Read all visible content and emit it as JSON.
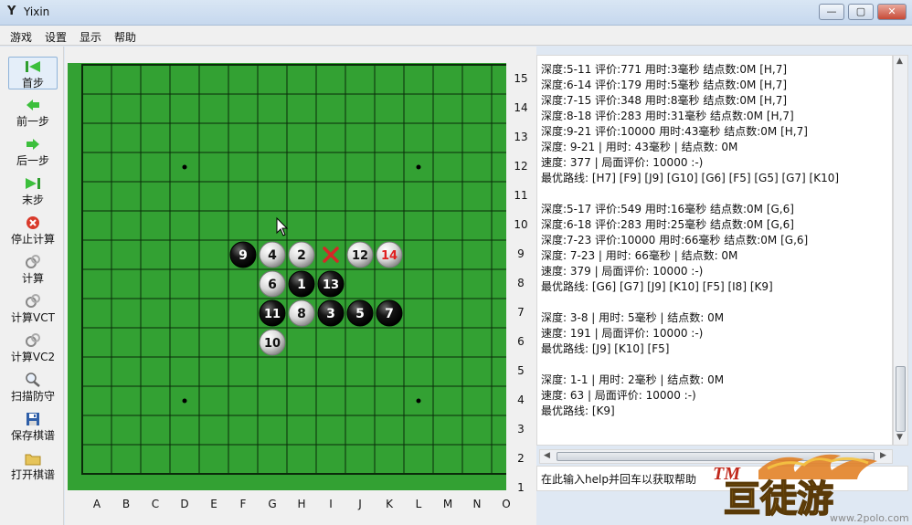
{
  "window": {
    "title": "Yixin",
    "app_icon": "Y",
    "minimize_glyph": "—",
    "maximize_glyph": "▢",
    "close_glyph": "✕"
  },
  "menu": [
    "游戏",
    "设置",
    "显示",
    "帮助"
  ],
  "toolbar": [
    {
      "label": "首步",
      "icon": "first-step-icon",
      "active": true
    },
    {
      "label": "前一步",
      "icon": "prev-step-icon"
    },
    {
      "label": "后一步",
      "icon": "next-step-icon"
    },
    {
      "label": "末步",
      "icon": "last-step-icon"
    },
    {
      "label": "停止计算",
      "icon": "stop-icon"
    },
    {
      "label": "计算",
      "icon": "compute-icon"
    },
    {
      "label": "计算VCT",
      "icon": "compute-vct-icon"
    },
    {
      "label": "计算VC2",
      "icon": "compute-vc2-icon"
    },
    {
      "label": "扫描防守",
      "icon": "scan-icon"
    },
    {
      "label": "保存棋谱",
      "icon": "save-icon"
    },
    {
      "label": "打开棋谱",
      "icon": "open-folder-icon"
    }
  ],
  "board": {
    "columns": [
      "A",
      "B",
      "C",
      "D",
      "E",
      "F",
      "G",
      "H",
      "I",
      "J",
      "K",
      "L",
      "M",
      "N",
      "O"
    ],
    "rows": [
      "15",
      "14",
      "13",
      "12",
      "11",
      "10",
      "9",
      "8",
      "7",
      "6",
      "5",
      "4",
      "3",
      "2",
      "1"
    ],
    "star_points": [
      "D12",
      "L12",
      "D4",
      "L4"
    ],
    "stones": [
      {
        "pos": "H8",
        "color": "black",
        "n": "1"
      },
      {
        "pos": "H9",
        "color": "white",
        "n": "2"
      },
      {
        "pos": "I7",
        "color": "black",
        "n": "3"
      },
      {
        "pos": "G9",
        "color": "white",
        "n": "4"
      },
      {
        "pos": "J7",
        "color": "black",
        "n": "5"
      },
      {
        "pos": "G8",
        "color": "white",
        "n": "6"
      },
      {
        "pos": "K7",
        "color": "black",
        "n": "7"
      },
      {
        "pos": "H7",
        "color": "white",
        "n": "8"
      },
      {
        "pos": "F9",
        "color": "black",
        "n": "9"
      },
      {
        "pos": "G6",
        "color": "white",
        "n": "10"
      },
      {
        "pos": "G7",
        "color": "black",
        "n": "11"
      },
      {
        "pos": "J9",
        "color": "white",
        "n": "12"
      },
      {
        "pos": "I8",
        "color": "black",
        "n": "13"
      },
      {
        "pos": "K9",
        "color": "white",
        "n": "14",
        "last": true
      }
    ],
    "marker": "I9",
    "colors": {
      "board": "#33a133",
      "line": "#0a2a0a",
      "last_move": "#e02020",
      "marker": "#d62828"
    }
  },
  "log": [
    "深度:5-11 评价:771 用时:3毫秒 结点数:0M [H,7]",
    "深度:6-14 评价:179 用时:5毫秒 结点数:0M [H,7]",
    "深度:7-15 评价:348 用时:8毫秒 结点数:0M [H,7]",
    "深度:8-18 评价:283 用时:31毫秒 结点数:0M [H,7]",
    "深度:9-21 评价:10000 用时:43毫秒 结点数:0M [H,7]",
    "深度: 9-21 | 用时: 43毫秒 | 结点数: 0M",
    "速度: 377 | 局面评价: 10000 :-)",
    "最优路线: [H7] [F9] [J9] [G10] [G6] [F5] [G5] [G7] [K10]",
    "",
    "深度:5-17 评价:549 用时:16毫秒 结点数:0M [G,6]",
    "深度:6-18 评价:283 用时:25毫秒 结点数:0M [G,6]",
    "深度:7-23 评价:10000 用时:66毫秒 结点数:0M [G,6]",
    "深度: 7-23 | 用时: 66毫秒 | 结点数: 0M",
    "速度: 379 | 局面评价: 10000 :-)",
    "最优路线: [G6] [G7] [J9] [K10] [F5] [I8] [K9]",
    "",
    "深度: 3-8 | 用时: 5毫秒 | 结点数: 0M",
    "速度: 191 | 局面评价: 10000 :-)",
    "最优路线: [J9] [K10] [F5]",
    "",
    "深度: 1-1 | 用时: 2毫秒 | 结点数: 0M",
    "速度: 63 | 局面评价: 10000 :-)",
    "最优路线: [K9]"
  ],
  "command_input": {
    "value": "在此输入help并回车以获取帮助"
  },
  "watermark": {
    "text": "亘徒游",
    "tm": "TM",
    "url": "www.2polo.com"
  }
}
